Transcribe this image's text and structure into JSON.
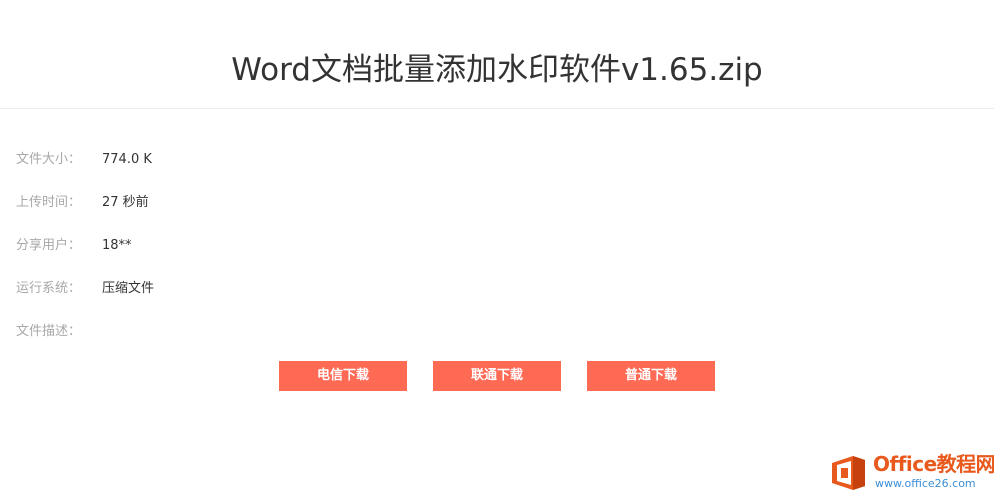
{
  "title": "Word文档批量添加水印软件v1.65.zip",
  "info": [
    {
      "label": "文件大小：",
      "value": "774.0 K"
    },
    {
      "label": "上传时间：",
      "value": "27 秒前"
    },
    {
      "label": "分享用户：",
      "value": "18**"
    },
    {
      "label": "运行系统：",
      "value": "压缩文件"
    },
    {
      "label": "文件描述：",
      "value": ""
    }
  ],
  "buttons": [
    {
      "label": "电信下载"
    },
    {
      "label": "联通下载"
    },
    {
      "label": "普通下载"
    }
  ],
  "watermark": {
    "icon": "office-logo-icon",
    "name": "Office教程网",
    "url": "www.office26.com"
  },
  "colors": {
    "button": "#ff6a55",
    "watermark_name": "#e8591d",
    "watermark_url": "#3a8ed6"
  }
}
